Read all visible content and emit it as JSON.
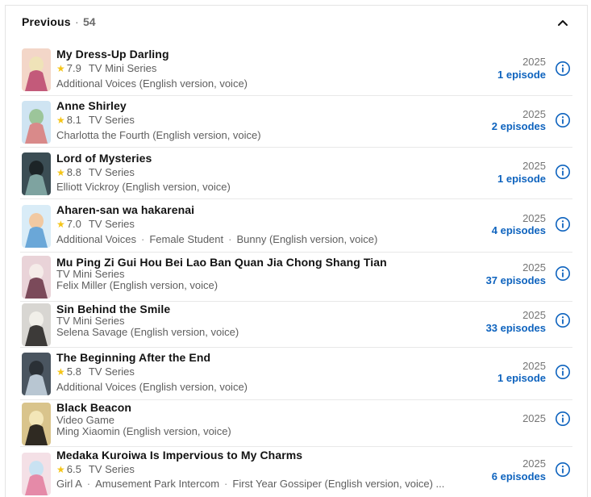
{
  "section": {
    "title": "Previous",
    "separator": "·",
    "count": "54"
  },
  "credits": [
    {
      "title": "My Dress-Up Darling",
      "rating": "7.9",
      "type": "TV Mini Series",
      "roles": [
        "Additional Voices (English version, voice)"
      ],
      "year": "2025",
      "episodes": "1 episode",
      "poster": {
        "bg": "#f3d6c8",
        "accent": "#c35a7a",
        "accent2": "#efe3b8"
      }
    },
    {
      "title": "Anne Shirley",
      "rating": "8.1",
      "type": "TV Series",
      "roles": [
        "Charlotta the Fourth (English version, voice)"
      ],
      "year": "2025",
      "episodes": "2 episodes",
      "poster": {
        "bg": "#cfe4f2",
        "accent": "#d98a8a",
        "accent2": "#9cc59a"
      }
    },
    {
      "title": "Lord of Mysteries",
      "rating": "8.8",
      "type": "TV Series",
      "roles": [
        "Elliott Vickroy (English version, voice)"
      ],
      "year": "2025",
      "episodes": "1 episode",
      "poster": {
        "bg": "#3b4d54",
        "accent": "#7ea3a0",
        "accent2": "#1c2427"
      }
    },
    {
      "title": "Aharen-san wa hakarenai",
      "rating": "7.0",
      "type": "TV Series",
      "roles": [
        "Additional Voices",
        "Female Student",
        "Bunny (English version, voice)"
      ],
      "year": "2025",
      "episodes": "4 episodes",
      "poster": {
        "bg": "#d9ecf7",
        "accent": "#6aa7d8",
        "accent2": "#f1c9a2"
      }
    },
    {
      "title": "Mu Ping Zi Gui Hou Bei Lao Ban Quan Jia Chong Shang Tian",
      "rating": "",
      "type": "TV Mini Series",
      "roles": [
        "Felix Miller (English version, voice)"
      ],
      "year": "2025",
      "episodes": "37 episodes",
      "poster": {
        "bg": "#e9d3d8",
        "accent": "#7b4a5a",
        "accent2": "#f5ece9"
      }
    },
    {
      "title": "Sin Behind the Smile",
      "rating": "",
      "type": "TV Mini Series",
      "roles": [
        "Selena Savage (English version, voice)"
      ],
      "year": "2025",
      "episodes": "33 episodes",
      "poster": {
        "bg": "#d8d6d2",
        "accent": "#3c3a38",
        "accent2": "#f1efe9"
      }
    },
    {
      "title": "The Beginning After the End",
      "rating": "5.8",
      "type": "TV Series",
      "roles": [
        "Additional Voices (English version, voice)"
      ],
      "year": "2025",
      "episodes": "1 episode",
      "poster": {
        "bg": "#4a5560",
        "accent": "#b8c6d2",
        "accent2": "#2a3036"
      }
    },
    {
      "title": "Black Beacon",
      "rating": "",
      "type": "Video Game",
      "roles": [
        "Ming Xiaomin (English version, voice)"
      ],
      "year": "2025",
      "episodes": "",
      "poster": {
        "bg": "#d9c48c",
        "accent": "#2f2a22",
        "accent2": "#f3e6b8"
      }
    },
    {
      "title": "Medaka Kuroiwa Is Impervious to My Charms",
      "rating": "6.5",
      "type": "TV Series",
      "roles": [
        "Girl A",
        "Amusement Park Intercom",
        "First Year Gossiper (English version, voice) ..."
      ],
      "year": "2025",
      "episodes": "6 episodes",
      "poster": {
        "bg": "#f4e0e6",
        "accent": "#e58aa8",
        "accent2": "#c9e2f2"
      }
    }
  ],
  "colors": {
    "link": "#0e63be",
    "star": "#f5c518",
    "muted": "#5e5e5e"
  },
  "icons": {
    "collapse": "chevron-up-icon",
    "info": "info-circle-icon",
    "star": "star-icon"
  }
}
